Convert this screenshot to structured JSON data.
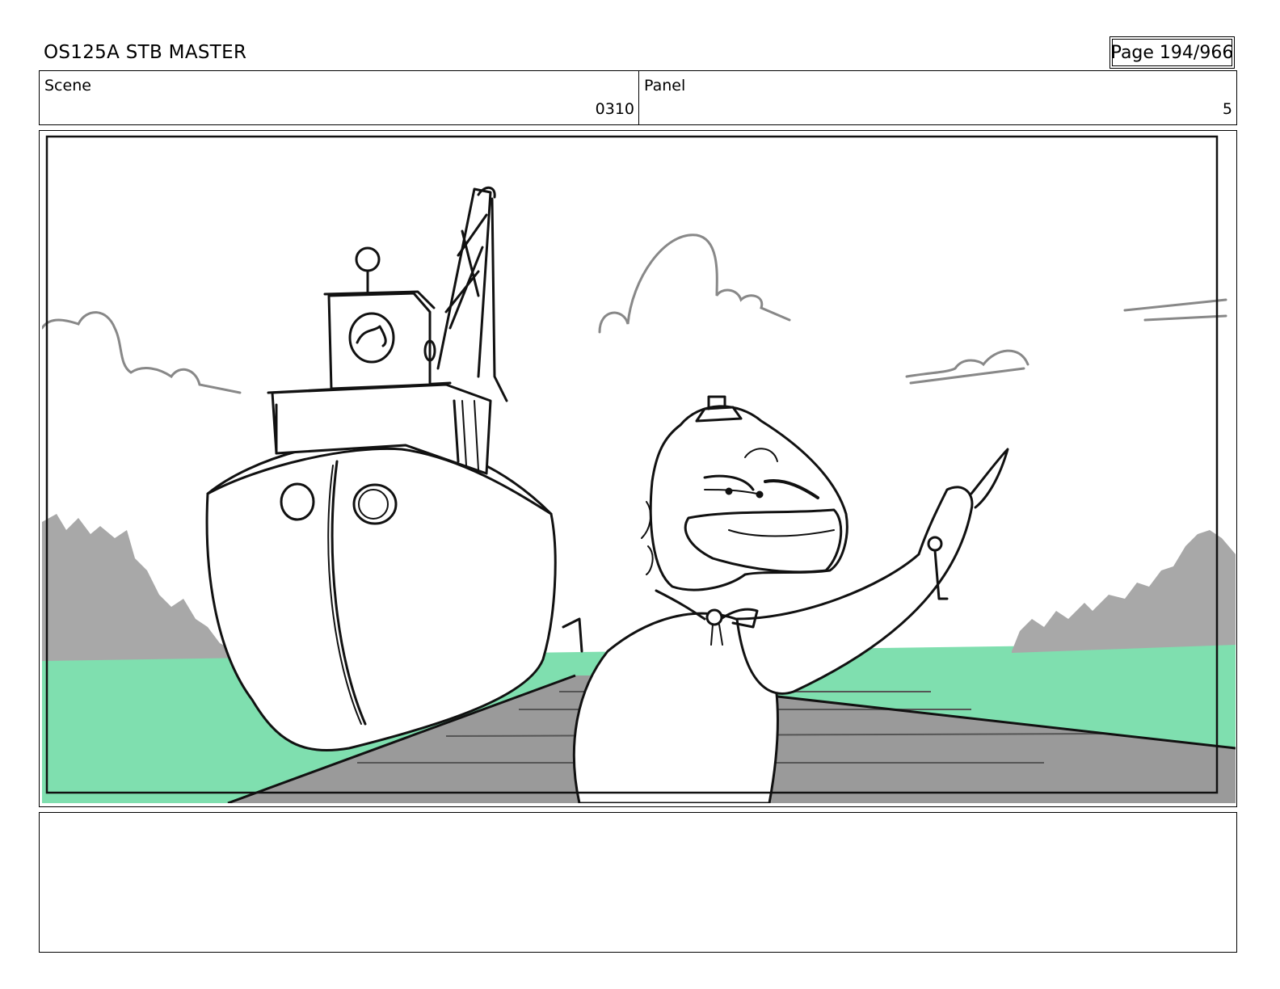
{
  "header": {
    "document_title": "OS125A STB MASTER",
    "page_label": "Page 194/966"
  },
  "info": {
    "scene_label": "Scene",
    "scene_value": "0310",
    "panel_label": "Panel",
    "panel_value": "5"
  },
  "colors": {
    "water": "#7fdfaf",
    "trees": "#a8a8a8",
    "dock": "#9a9a9a",
    "ink": "#111111",
    "cloud": "#888888"
  },
  "notes": {
    "text": ""
  }
}
